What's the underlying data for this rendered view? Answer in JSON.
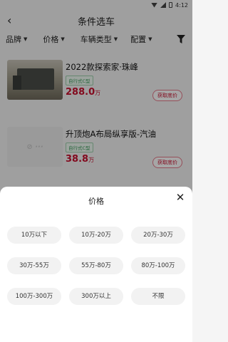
{
  "status_bar": {
    "time": "4:12"
  },
  "header": {
    "title": "条件选车"
  },
  "filters": [
    {
      "label": "品牌"
    },
    {
      "label": "价格"
    },
    {
      "label": "车辆类型"
    },
    {
      "label": "配置"
    }
  ],
  "listings": [
    {
      "name": "2022款探索家·珠峰",
      "tag": "自行式C型",
      "price": "288.0",
      "unit": "万",
      "button": "获取底价",
      "image": "photo"
    },
    {
      "name": "升顶炮A布局纵享版-汽油",
      "tag": "自行式C型",
      "price": "38.8",
      "unit": "万",
      "button": "获取底价",
      "image": "placeholder"
    }
  ],
  "sheet": {
    "title": "价格",
    "options": [
      "10万以下",
      "10万-20万",
      "20万-30万",
      "30万-55万",
      "55万-80万",
      "80万-100万",
      "100万-300万",
      "300万以上",
      "不限"
    ]
  },
  "colors": {
    "accent": "#c8102e",
    "tag_green": "#3a9b59"
  }
}
